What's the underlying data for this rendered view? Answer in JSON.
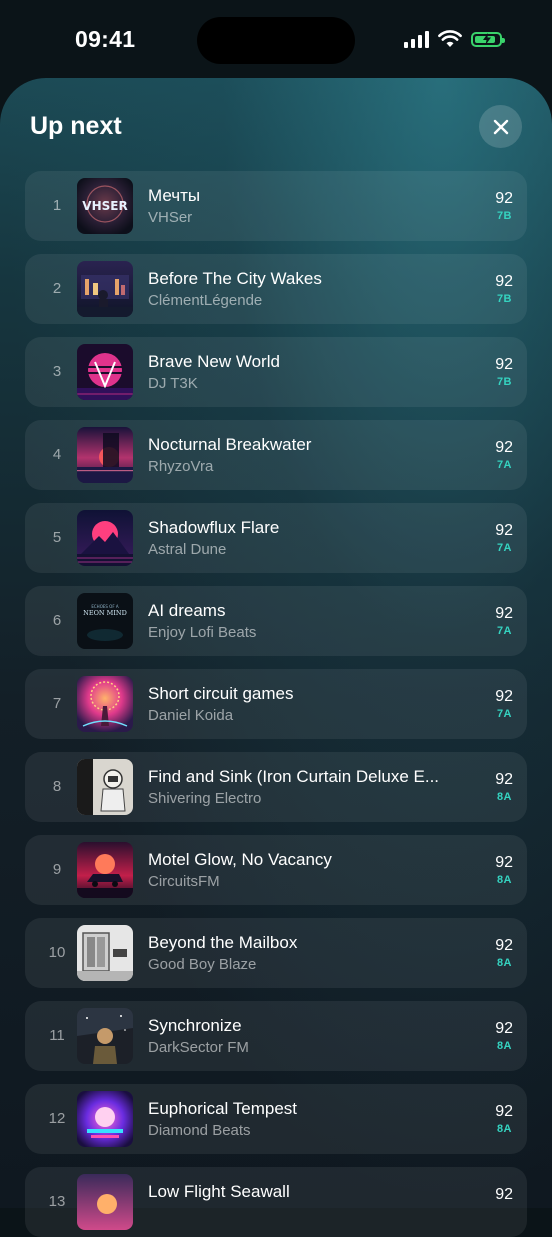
{
  "status_bar": {
    "time": "09:41",
    "icons": [
      "cellular-signal-icon",
      "wifi-icon",
      "battery-charging-icon"
    ]
  },
  "sheet": {
    "title": "Up next",
    "close_icon": "close-icon"
  },
  "tracks": [
    {
      "index": "1",
      "title": "Мечты",
      "artist": "VHSer",
      "bpm": "92",
      "key": "7B",
      "art": "art-vhser"
    },
    {
      "index": "2",
      "title": "Before The City Wakes",
      "artist": "ClémentLégende",
      "bpm": "92",
      "key": "7B",
      "art": "art-city"
    },
    {
      "index": "3",
      "title": "Brave New World",
      "artist": "DJ T3K",
      "bpm": "92",
      "key": "7B",
      "art": "art-brave"
    },
    {
      "index": "4",
      "title": "Nocturnal Breakwater",
      "artist": "RhyzoVra",
      "bpm": "92",
      "key": "7A",
      "art": "art-nocturnal"
    },
    {
      "index": "5",
      "title": "Shadowflux Flare",
      "artist": "Astral Dune",
      "bpm": "92",
      "key": "7A",
      "art": "art-shadowflux"
    },
    {
      "index": "6",
      "title": "AI dreams",
      "artist": "Enjoy Lofi Beats",
      "bpm": "92",
      "key": "7A",
      "art": "art-ai-dreams"
    },
    {
      "index": "7",
      "title": "Short circuit games",
      "artist": "Daniel Koida",
      "bpm": "92",
      "key": "7A",
      "art": "art-short-circuit"
    },
    {
      "index": "8",
      "title": "Find and Sink (Iron Curtain Deluxe E...",
      "artist": "Shivering Electro",
      "bpm": "92",
      "key": "8A",
      "art": "art-find-sink"
    },
    {
      "index": "9",
      "title": "Motel Glow, No Vacancy",
      "artist": "CircuitsFM",
      "bpm": "92",
      "key": "8A",
      "art": "art-motel"
    },
    {
      "index": "10",
      "title": "Beyond the Mailbox",
      "artist": "Good Boy Blaze",
      "bpm": "92",
      "key": "8A",
      "art": "art-mailbox"
    },
    {
      "index": "11",
      "title": "Synchronize",
      "artist": "DarkSector FM",
      "bpm": "92",
      "key": "8A",
      "art": "art-synchronize"
    },
    {
      "index": "12",
      "title": "Euphorical Tempest",
      "artist": "Diamond Beats",
      "bpm": "92",
      "key": "8A",
      "art": "art-euphorical"
    },
    {
      "index": "13",
      "title": "Low Flight Seawall",
      "artist": "",
      "bpm": "92",
      "key": "",
      "art": "art-low-flight"
    }
  ],
  "art_text": {
    "vhser": "VHSER",
    "ai_dreams_top": "ECHOES OF A",
    "ai_dreams_bottom": "NEON MIND"
  },
  "colors": {
    "accent_key": "#35d3c0",
    "sheet_top": "#1c4a55",
    "sheet_bottom": "#0f1820"
  }
}
